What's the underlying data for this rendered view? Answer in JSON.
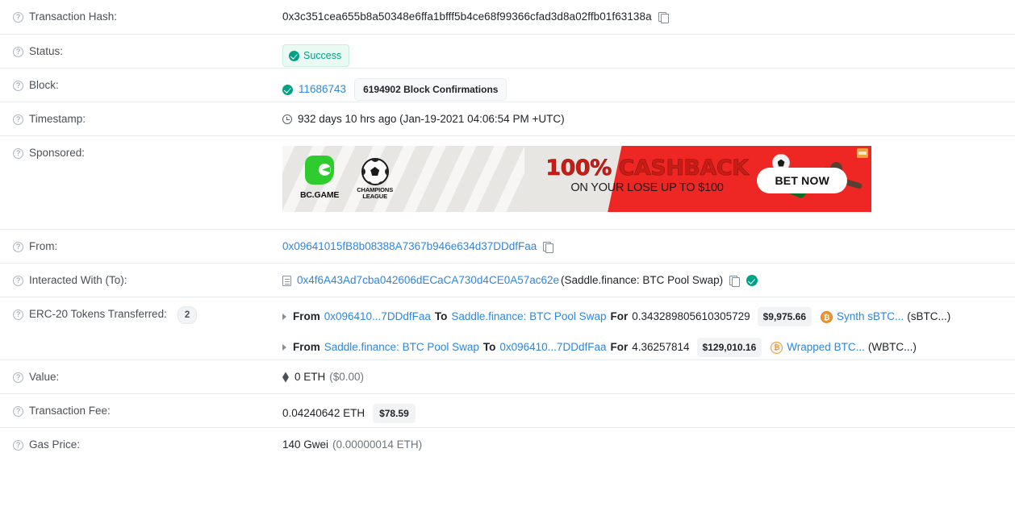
{
  "rows": {
    "tx_hash": {
      "label": "Transaction Hash:",
      "value": "0x3c351cea655b8a50348e6ffa1bfff5b4ce68f99366cfad3d8a02ffb01f63138a"
    },
    "status": {
      "label": "Status:",
      "value": "Success"
    },
    "block": {
      "label": "Block:",
      "number": "11686743",
      "confirmations": "6194902 Block Confirmations"
    },
    "timestamp": {
      "label": "Timestamp:",
      "value": "932 days 10 hrs ago (Jan-19-2021 04:06:54 PM +UTC)"
    },
    "sponsored": {
      "label": "Sponsored:"
    },
    "from": {
      "label": "From:",
      "value": "0x09641015fB8b08388A7367b946e634d37DDdfFaa"
    },
    "interacted_with": {
      "label": "Interacted With (To):",
      "address": "0x4f6A43Ad7cba042606dECaCA730d4CE0A57ac62e",
      "name": "(Saddle.finance: BTC Pool Swap)"
    },
    "erc20": {
      "label": "ERC-20 Tokens Transferred:",
      "count": "2"
    },
    "value": {
      "label": "Value:",
      "amount": "0 ETH",
      "usd": "($0.00)"
    },
    "tx_fee": {
      "label": "Transaction Fee:",
      "amount": "0.04240642 ETH",
      "usd": "$78.59"
    },
    "gas_price": {
      "label": "Gas Price:",
      "amount": "140 Gwei",
      "eth": "(0.00000014 ETH)"
    }
  },
  "transfers": [
    {
      "from_word": "From",
      "from": "0x096410...7DDdfFaa",
      "to_word": "To",
      "to": "Saddle.finance: BTC Pool Swap",
      "for_word": "For",
      "amount": "0.343289805610305729",
      "usd": "$9,975.66",
      "token_name": "Synth sBTC...",
      "token_symbol": "(sBTC...)",
      "token_icon": "sbtc-token-icon",
      "token_glyph": "₿"
    },
    {
      "from_word": "From",
      "from": "Saddle.finance: BTC Pool Swap",
      "to_word": "To",
      "to": "0x096410...7DDdfFaa",
      "for_word": "For",
      "amount": "4.36257814",
      "usd": "$129,010.16",
      "token_name": "Wrapped BTC...",
      "token_symbol": "(WBTC...)",
      "token_icon": "wbtc-token-icon",
      "token_glyph": "₿"
    }
  ],
  "ad": {
    "brand": "BC.GAME",
    "league_line1": "CHAMPIONS",
    "league_line2": "LEAGUE",
    "headline": "100% CASHBACK",
    "subhead": "ON YOUR LOSE UP TO $100",
    "cta": "BET NOW"
  },
  "icons": {
    "help": "?",
    "copy": "copy-icon",
    "clock": "clock-icon",
    "verified": "verified-check-icon"
  },
  "colors": {
    "link": "#2e86de",
    "success": "#00a186",
    "ad_red": "#ee2725",
    "ad_green": "#2ecc2e",
    "token_orange": "#f0962a"
  }
}
